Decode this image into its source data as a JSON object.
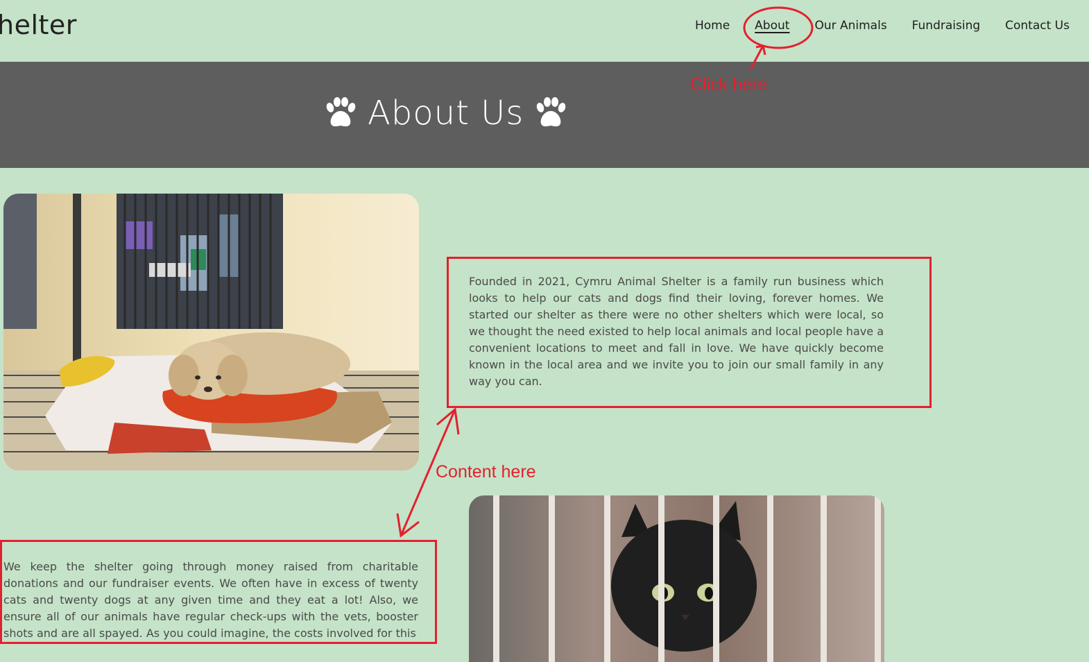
{
  "nav": {
    "brand": "helter",
    "links": [
      "Home",
      "About",
      "Our Animals",
      "Fundraising",
      "Contact Us"
    ],
    "active": "About"
  },
  "hero": {
    "title": "About Us",
    "icon": "paw-icon"
  },
  "content": {
    "paragraph_1": "Founded in 2021, Cymru Animal Shelter is a family run business which looks to help our cats and dogs find their loving, forever homes. We started our shelter as there were no other shelters which were local, so we thought the need existed to help local animals and local people have a convenient locations to meet and fall in love. We have quickly become known in the local area and we invite you to join our small family in any way you can.",
    "paragraph_2": "We keep the shelter going through money raised from charitable donations and our fundraiser events. We often have in excess of twenty cats and twenty dogs at any given time and they eat a lot! Also, we ensure all of our animals have regular check-ups with the vets, booster shots and are all spayed. As you could imagine, the costs involved for this"
  },
  "annotations": {
    "click_hint": "Click here",
    "content_hint": "Content here"
  },
  "colors": {
    "page_bg": "#c5e3c8",
    "hero_bg": "#5e5e5e",
    "annotation": "#e3202e"
  }
}
